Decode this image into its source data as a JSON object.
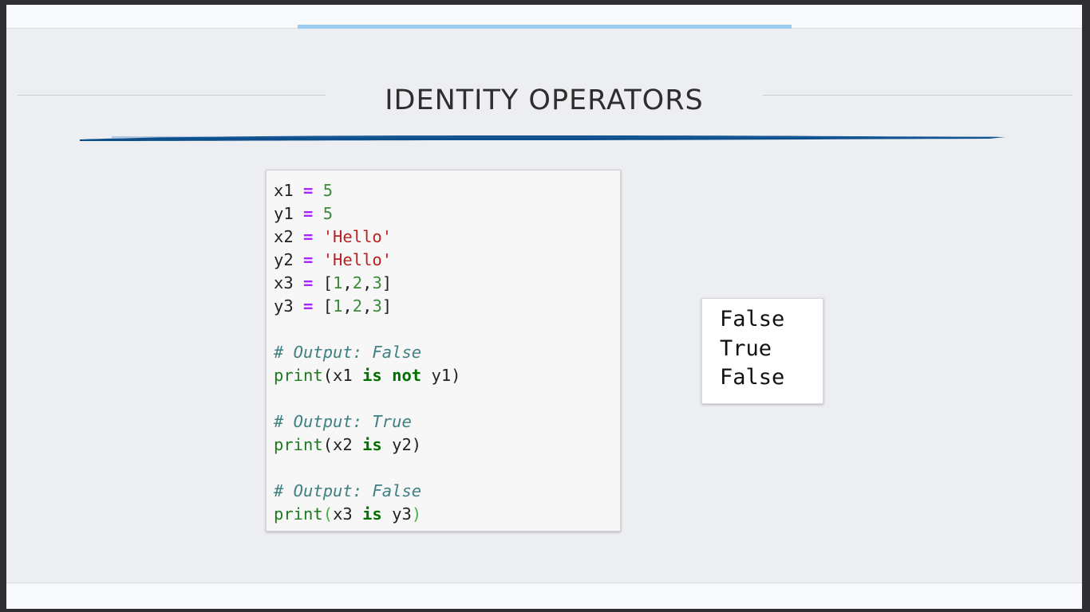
{
  "slide": {
    "title": "IDENTITY OPERATORS",
    "code": {
      "lines": [
        [
          {
            "t": "x1 ",
            "c": ""
          },
          {
            "t": "=",
            "c": "op"
          },
          {
            "t": " ",
            "c": ""
          },
          {
            "t": "5",
            "c": "num"
          }
        ],
        [
          {
            "t": "y1 ",
            "c": ""
          },
          {
            "t": "=",
            "c": "op"
          },
          {
            "t": " ",
            "c": ""
          },
          {
            "t": "5",
            "c": "num"
          }
        ],
        [
          {
            "t": "x2 ",
            "c": ""
          },
          {
            "t": "=",
            "c": "op"
          },
          {
            "t": " ",
            "c": ""
          },
          {
            "t": "'Hello'",
            "c": "str"
          }
        ],
        [
          {
            "t": "y2 ",
            "c": ""
          },
          {
            "t": "=",
            "c": "op"
          },
          {
            "t": " ",
            "c": ""
          },
          {
            "t": "'Hello'",
            "c": "str"
          }
        ],
        [
          {
            "t": "x3 ",
            "c": ""
          },
          {
            "t": "=",
            "c": "op"
          },
          {
            "t": " [",
            "c": ""
          },
          {
            "t": "1",
            "c": "num"
          },
          {
            "t": ",",
            "c": ""
          },
          {
            "t": "2",
            "c": "num"
          },
          {
            "t": ",",
            "c": ""
          },
          {
            "t": "3",
            "c": "num"
          },
          {
            "t": "]",
            "c": ""
          }
        ],
        [
          {
            "t": "y3 ",
            "c": ""
          },
          {
            "t": "=",
            "c": "op"
          },
          {
            "t": " [",
            "c": ""
          },
          {
            "t": "1",
            "c": "num"
          },
          {
            "t": ",",
            "c": ""
          },
          {
            "t": "2",
            "c": "num"
          },
          {
            "t": ",",
            "c": ""
          },
          {
            "t": "3",
            "c": "num"
          },
          {
            "t": "]",
            "c": ""
          }
        ],
        [],
        [
          {
            "t": "# Output: False",
            "c": "com"
          }
        ],
        [
          {
            "t": "print",
            "c": "bi"
          },
          {
            "t": "(x1 ",
            "c": ""
          },
          {
            "t": "is",
            "c": "kw"
          },
          {
            "t": " ",
            "c": ""
          },
          {
            "t": "not",
            "c": "kw"
          },
          {
            "t": " y1)",
            "c": ""
          }
        ],
        [],
        [
          {
            "t": "# Output: True",
            "c": "com"
          }
        ],
        [
          {
            "t": "print",
            "c": "bi"
          },
          {
            "t": "(x2 ",
            "c": ""
          },
          {
            "t": "is",
            "c": "kw"
          },
          {
            "t": " y2)",
            "c": ""
          }
        ],
        [],
        [
          {
            "t": "# Output: False",
            "c": "com"
          }
        ],
        [
          {
            "t": "print",
            "c": "bi"
          },
          {
            "t": "(",
            "c": "dim"
          },
          {
            "t": "x3 ",
            "c": ""
          },
          {
            "t": "is",
            "c": "kw"
          },
          {
            "t": " y3",
            "c": ""
          },
          {
            "t": ")",
            "c": "dim"
          }
        ]
      ]
    },
    "output": {
      "lines": [
        "False",
        "True",
        "False"
      ]
    }
  },
  "colors": {
    "title_underline": "#0d4f8b",
    "top_accent": "#9ccbf2",
    "operator": "#aa22ff",
    "number": "#3c8a3c",
    "string": "#ba2121",
    "comment": "#408080",
    "keyword": "#007000"
  }
}
